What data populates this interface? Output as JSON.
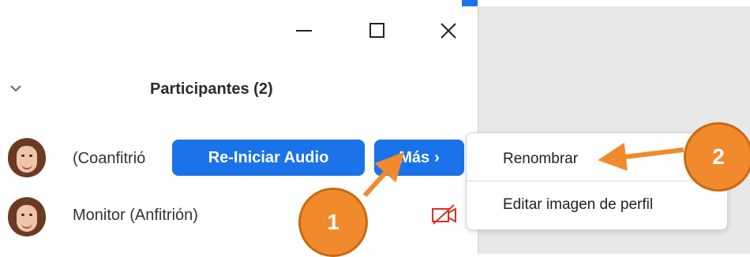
{
  "window": {
    "minimize_label": "minimize",
    "maximize_label": "maximize",
    "close_label": "close"
  },
  "panel": {
    "title": "Participantes (2)",
    "participants": [
      {
        "name": "(Coanfitrió",
        "buttons": {
          "audio": "Re-Iniciar Audio",
          "more": "Más",
          "more_chevron": "›"
        }
      },
      {
        "name": "Monitor (Anfitrión)",
        "status_icon": "camera-off-icon"
      }
    ]
  },
  "context_menu": {
    "items": [
      "Renombrar",
      "Editar imagen de perfil"
    ]
  },
  "callouts": [
    "1",
    "2"
  ],
  "colors": {
    "accent_blue": "#1a73e8",
    "callout_orange": "#f08a2c",
    "camera_off_red": "#d93025",
    "side_gray": "#e8e8e8"
  }
}
